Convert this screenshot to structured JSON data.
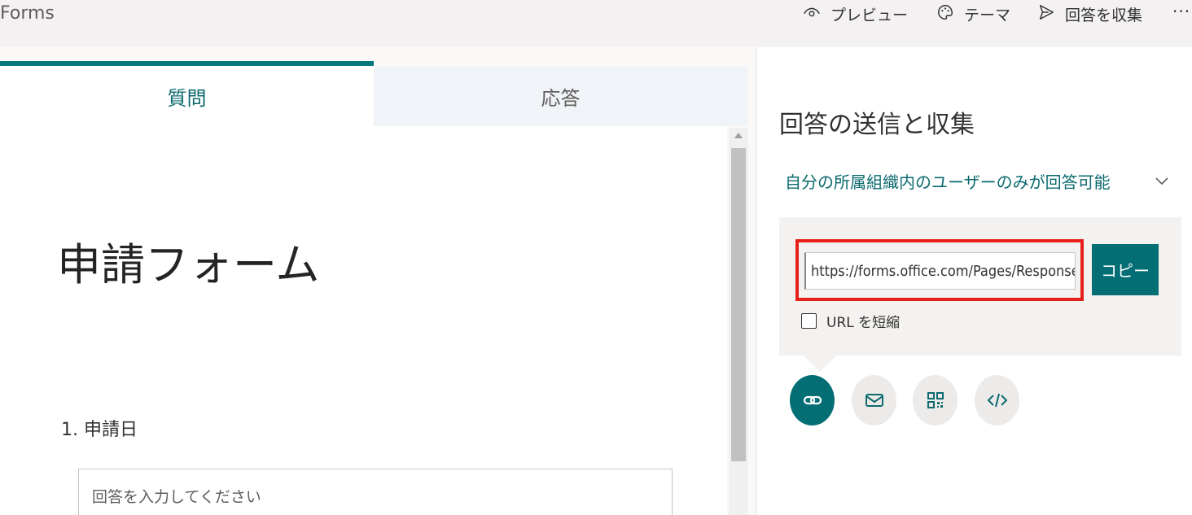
{
  "app": {
    "title": "Forms"
  },
  "topbar": {
    "preview_label": "プレビュー",
    "theme_label": "テーマ",
    "collect_label": "回答を収集",
    "more_label": "···"
  },
  "tabs": [
    {
      "label": "質問"
    },
    {
      "label": "応答"
    }
  ],
  "form": {
    "title": "申請フォーム",
    "question_label": "1. 申請日",
    "answer_placeholder": "回答を入力してください"
  },
  "share": {
    "title": "回答の送信と収集",
    "access_option": "自分の所属組織内のユーザーのみが回答可能",
    "url": "https://forms.office.com/Pages/ResponsePage.aspx",
    "copy_label": "コピー",
    "shorten_label": "URL を短縮"
  },
  "colors": {
    "accent": "#046e75",
    "highlight": "#e8201a"
  }
}
